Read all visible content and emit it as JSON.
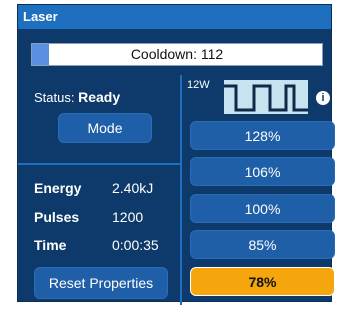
{
  "panel": {
    "title": "Laser"
  },
  "cooldown": {
    "text": "Cooldown: 112",
    "fill_fraction": 0.06
  },
  "status": {
    "label": "Status:",
    "value": "Ready"
  },
  "mode_button": "Mode",
  "stats": [
    {
      "label": "Energy",
      "value": "2.40kJ"
    },
    {
      "label": "Pulses",
      "value": "1200"
    },
    {
      "label": "Time",
      "value": "0:00:35"
    }
  ],
  "reset_button": "Reset Properties",
  "waveform": {
    "label": "12W",
    "icon": "square-wave-icon"
  },
  "info_icon": "i",
  "power_levels": [
    {
      "label": "128%",
      "selected": false
    },
    {
      "label": "106%",
      "selected": false
    },
    {
      "label": "100%",
      "selected": false
    },
    {
      "label": "85%",
      "selected": false
    },
    {
      "label": "78%",
      "selected": true
    }
  ],
  "colors": {
    "panel_bg": "#0d3a6a",
    "title_bar": "#1f6fc0",
    "button": "#1f5fa8",
    "selected": "#f6a60d",
    "progress_fill": "#5b8fe0",
    "wave_bg": "#c6e3ef"
  }
}
